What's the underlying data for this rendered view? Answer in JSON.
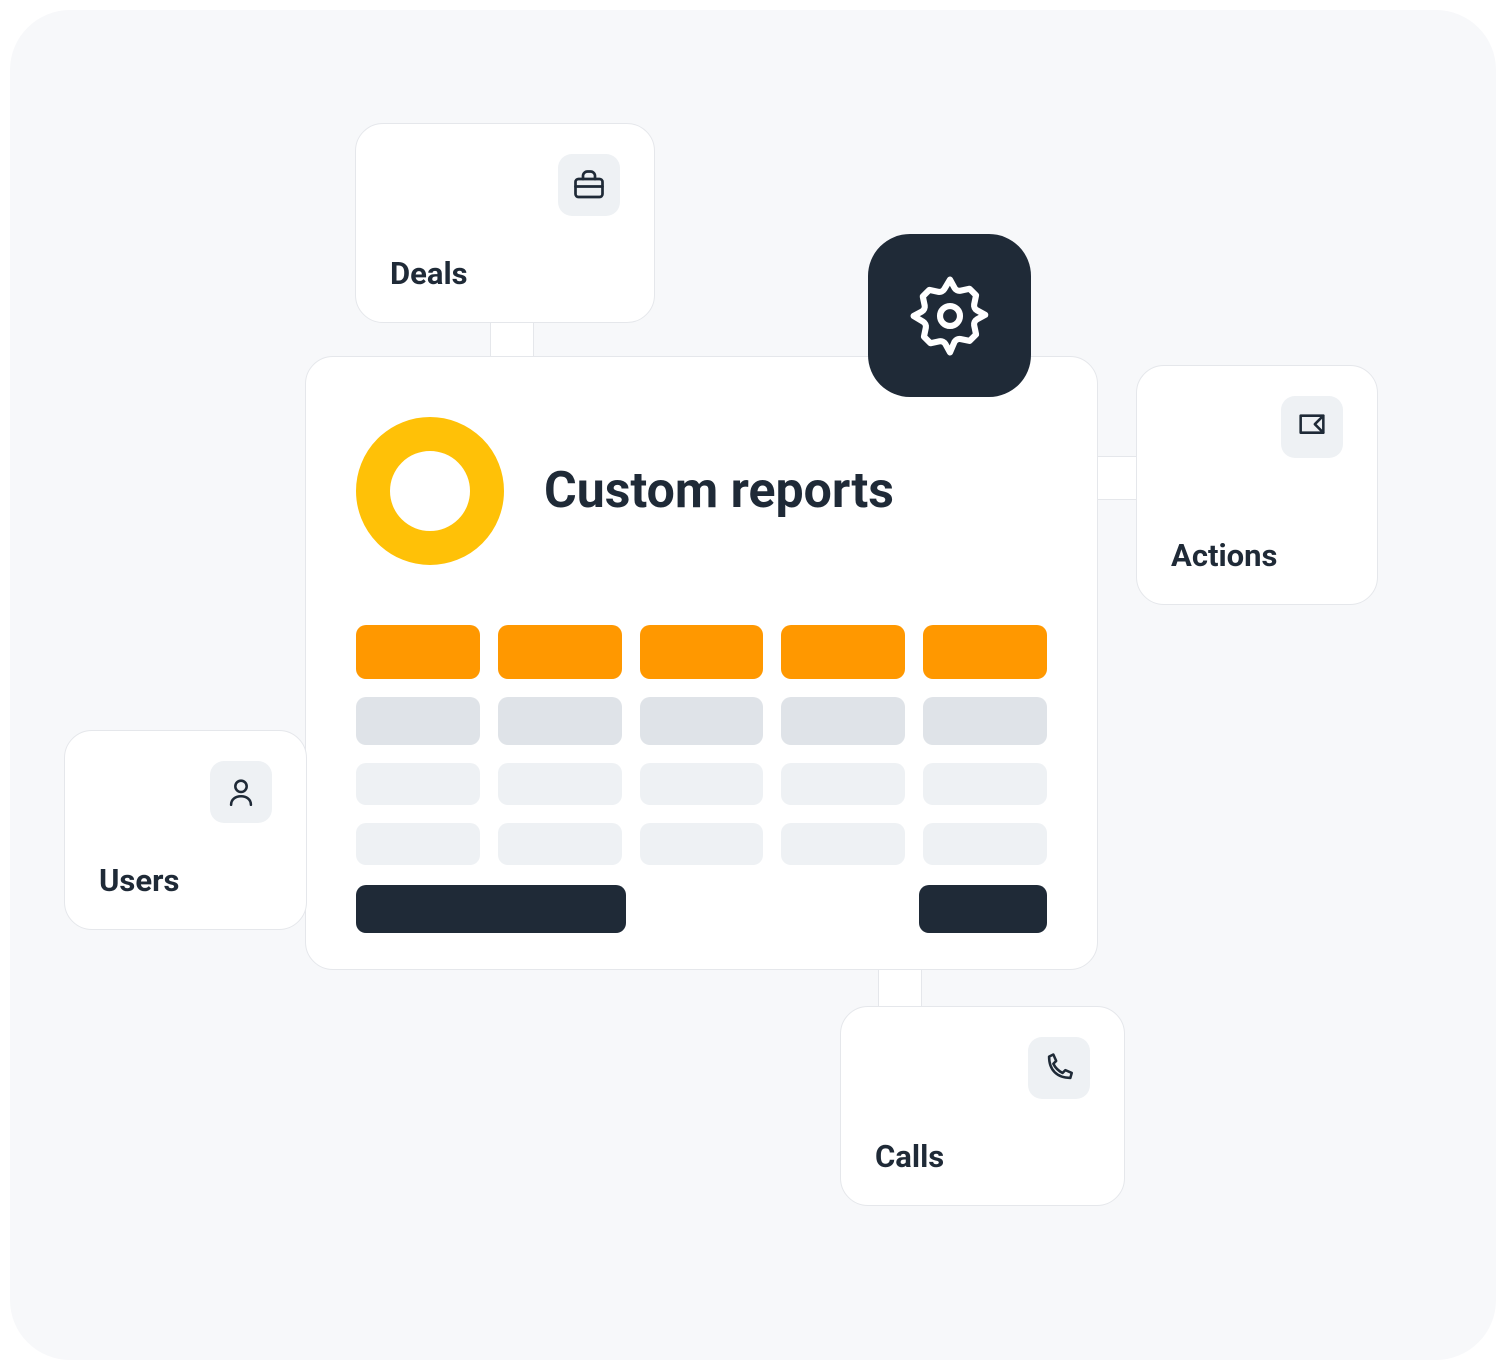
{
  "main": {
    "title": "Custom reports"
  },
  "cards": {
    "deals": {
      "label": "Deals",
      "icon": "briefcase-icon"
    },
    "users": {
      "label": "Users",
      "icon": "user-icon"
    },
    "actions": {
      "label": "Actions",
      "icon": "flag-icon"
    },
    "calls": {
      "label": "Calls",
      "icon": "phone-icon"
    }
  },
  "colors": {
    "accent_ring": "#ffc107",
    "accent_orange": "#ff9800",
    "dark": "#1f2a37",
    "grey_medium": "#dfe3e8",
    "grey_light": "#eef1f4",
    "background": "#f7f8fa"
  }
}
